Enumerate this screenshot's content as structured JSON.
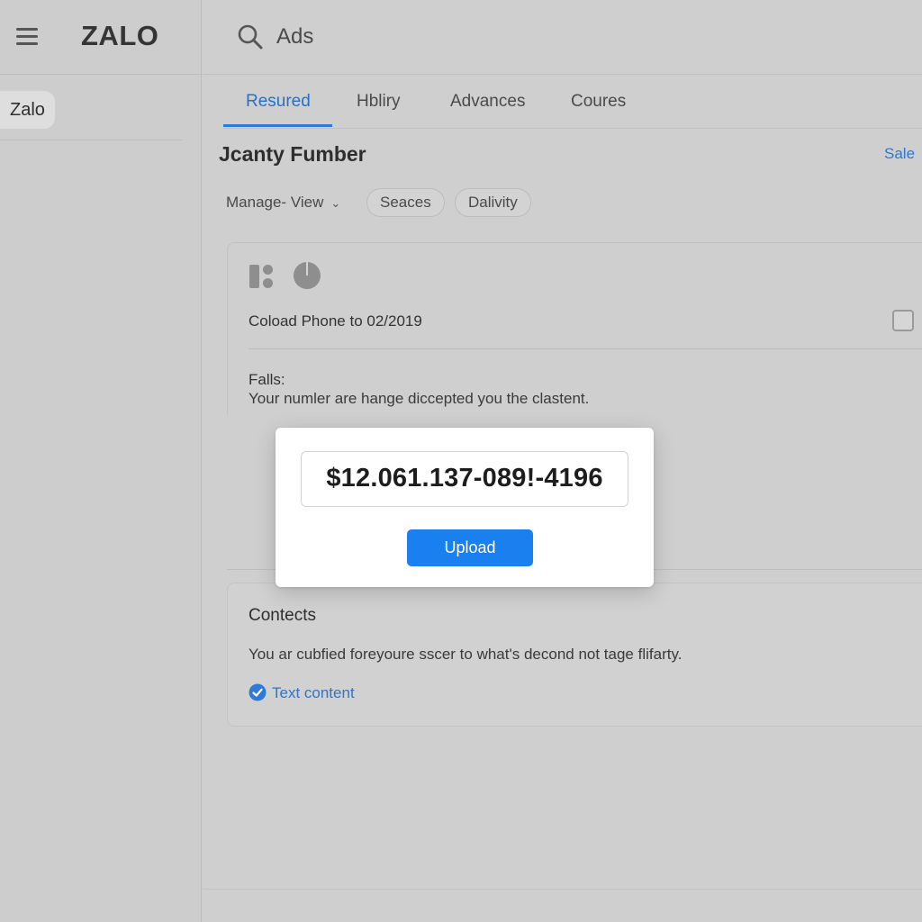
{
  "sidebar": {
    "logo": "ZALO",
    "items": [
      {
        "label": "Zalo"
      }
    ]
  },
  "topbar": {
    "search_text": "Ads"
  },
  "tabs": [
    {
      "label": "Resured",
      "active": true
    },
    {
      "label": "Hbliry",
      "active": false
    },
    {
      "label": "Advances",
      "active": false
    },
    {
      "label": "Coures",
      "active": false
    }
  ],
  "main": {
    "title": "Jcanty Fumber",
    "sale_link": "Sale",
    "filters": {
      "manage_view": "Manage- View",
      "chips": [
        "Seaces",
        "Dalivity"
      ]
    },
    "card1": {
      "row_text": "Coload Phone to 02/2019",
      "fails_label": "Falls:",
      "fails_text": "Your numler are hange diccepted you the clastent."
    },
    "card2": {
      "title": "Contects",
      "text": "You ar cubfied foreyoure sscer to what's decond not tage flifarty.",
      "link_label": "Text content"
    }
  },
  "modal": {
    "field_value": "$12.061.137-089!-4196",
    "upload_label": "Upload"
  },
  "colors": {
    "accent": "#2a7bd8",
    "button": "#1a80f0",
    "background": "#cfcfcf"
  }
}
